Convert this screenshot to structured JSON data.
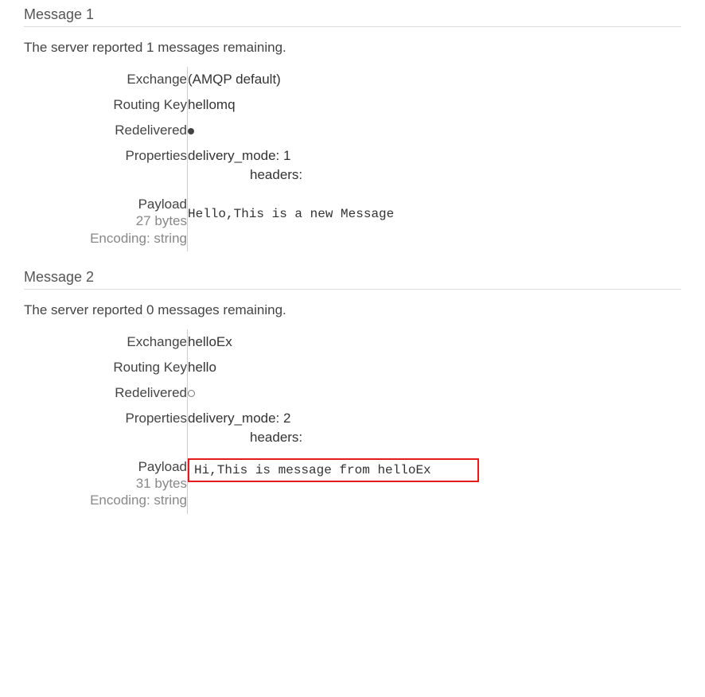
{
  "labels": {
    "exchange": "Exchange",
    "routing_key": "Routing Key",
    "redelivered": "Redelivered",
    "properties": "Properties",
    "payload": "Payload",
    "encodingPrefix": "Encoding: ",
    "bytesSuffix": " bytes",
    "remainingPrefix": "The server reported ",
    "remainingSuffix": " messages remaining.",
    "messagePrefix": "Message ",
    "delivery_mode_label": "delivery_mode:",
    "headers_label": "headers:"
  },
  "messages": [
    {
      "index": "1",
      "remaining": "1",
      "exchange": "(AMQP default)",
      "routing_key": "hellomq",
      "redelivered": true,
      "properties": {
        "delivery_mode": "1",
        "headers": ""
      },
      "payload": {
        "bytes": "27",
        "encoding": "string",
        "content": "Hello,This is a new Message",
        "highlight": false
      }
    },
    {
      "index": "2",
      "remaining": "0",
      "exchange": "helloEx",
      "routing_key": "hello",
      "redelivered": false,
      "properties": {
        "delivery_mode": "2",
        "headers": ""
      },
      "payload": {
        "bytes": "31",
        "encoding": "string",
        "content": "Hi,This is message from helloEx",
        "highlight": true
      }
    }
  ]
}
